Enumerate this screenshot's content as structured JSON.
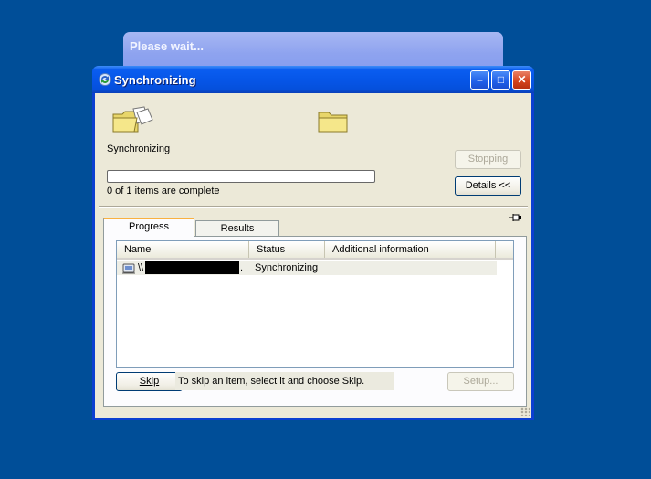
{
  "background_window": {
    "title": "Please wait..."
  },
  "window": {
    "title": "Synchronizing",
    "buttons": {
      "minimize": "–",
      "maximize": "□",
      "close": "✕"
    }
  },
  "status": {
    "label": "Synchronizing",
    "progress_text": "0 of 1 items are complete",
    "progress_fraction": 0
  },
  "buttons": {
    "stopping": "Stopping",
    "details": "Details <<",
    "skip": "Skip",
    "setup": "Setup..."
  },
  "tabs": [
    {
      "label": "Progress",
      "active": true
    },
    {
      "label": "Results",
      "active": false
    }
  ],
  "table": {
    "columns": [
      "Name",
      "Status",
      "Additional information"
    ],
    "rows": [
      {
        "name": "\\\\",
        "name_suffix": ".",
        "status": "Synchronizing",
        "info": ""
      }
    ]
  },
  "hint_text": "To skip an item, select it and choose Skip.",
  "icons": {
    "app": "sync-icon",
    "source": "open-folder-with-documents-icon",
    "target": "folder-icon",
    "pin": "pushpin-icon",
    "row": "network-share-icon"
  },
  "colors": {
    "desktop": "#004e98",
    "titlebar": "#0656e8",
    "dialog_bg": "#ece9d8",
    "active_tab_accent": "#f9b141"
  }
}
